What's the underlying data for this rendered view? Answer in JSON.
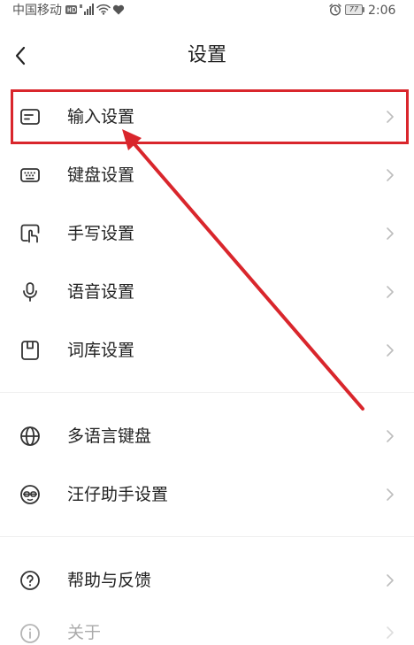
{
  "status_bar": {
    "carrier": "中国移动",
    "battery": "77",
    "time": "2:06",
    "icons_left": [
      "hd-icon",
      "signal-icon",
      "wifi-icon",
      "heart-icon"
    ],
    "icons_right": [
      "alarm-icon",
      "battery-icon"
    ]
  },
  "header": {
    "title": "设置",
    "back_icon": "chevron-left-icon"
  },
  "groups": [
    {
      "items": [
        {
          "label": "输入设置",
          "icon": "input-settings-icon",
          "highlighted": true
        },
        {
          "label": "键盘设置",
          "icon": "keyboard-icon"
        },
        {
          "label": "手写设置",
          "icon": "handwriting-icon"
        },
        {
          "label": "语音设置",
          "icon": "microphone-icon"
        },
        {
          "label": "词库设置",
          "icon": "dictionary-icon"
        }
      ]
    },
    {
      "items": [
        {
          "label": "多语言键盘",
          "icon": "globe-icon"
        },
        {
          "label": "汪仔助手设置",
          "icon": "assistant-icon"
        }
      ]
    },
    {
      "items": [
        {
          "label": "帮助与反馈",
          "icon": "help-icon"
        },
        {
          "label": "关于",
          "icon": "info-icon"
        }
      ]
    }
  ],
  "colors": {
    "highlight": "#d9262c",
    "text": "#222222",
    "chevron": "#bdbdbd",
    "background": "#ffffff"
  }
}
